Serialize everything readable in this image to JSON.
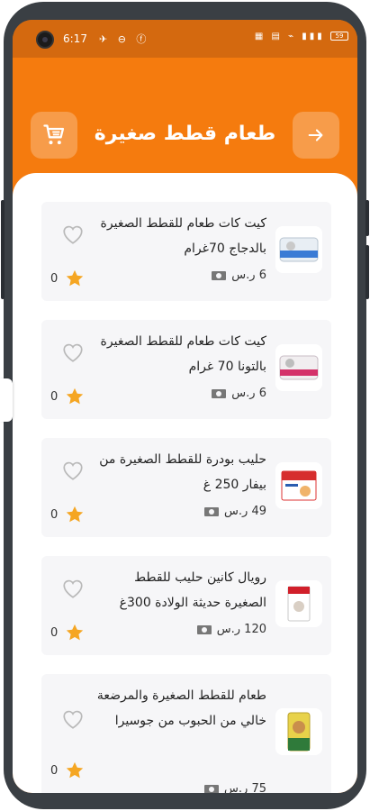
{
  "status_bar": {
    "time": "6:17",
    "left_icons": "✈ ⊖ ⓕ",
    "right_icons": "▦ ▤ ⌁ ▮▮▮",
    "battery": "59"
  },
  "header": {
    "title": "طعام قطط صغيرة",
    "back_icon": "arrow-right-icon",
    "cart_icon": "cart-icon"
  },
  "colors": {
    "accent": "#f57b0e",
    "status_bar": "#d4690f",
    "star": "#f5a623",
    "card_bg": "#f6f6f8"
  },
  "products": [
    {
      "name": "كيت كات طعام للقطط الصغيرة بالدجاج 70غرام",
      "price": "6 ر.س",
      "rating": "0",
      "image": "can-white-blue"
    },
    {
      "name": "كيت كات طعام للقطط الصغيرة بالتونا 70 غرام",
      "price": "6 ر.س",
      "rating": "0",
      "image": "can-white-pink"
    },
    {
      "name": "حليب بودرة للقطط الصغيرة من بيفار 250 غ",
      "price": "49 ر.س",
      "rating": "0",
      "image": "milk-box"
    },
    {
      "name": "رويال كانين حليب للقطط الصغيرة حديثة الولادة 300غ",
      "price": "120 ر.س",
      "rating": "0",
      "image": "royal-canin-box"
    },
    {
      "name": "طعام للقطط الصغيرة والمرضعة خالي من الحبوب من جوسيرا",
      "price": "75 ر.س",
      "rating": "0",
      "image": "josera-bag"
    }
  ]
}
